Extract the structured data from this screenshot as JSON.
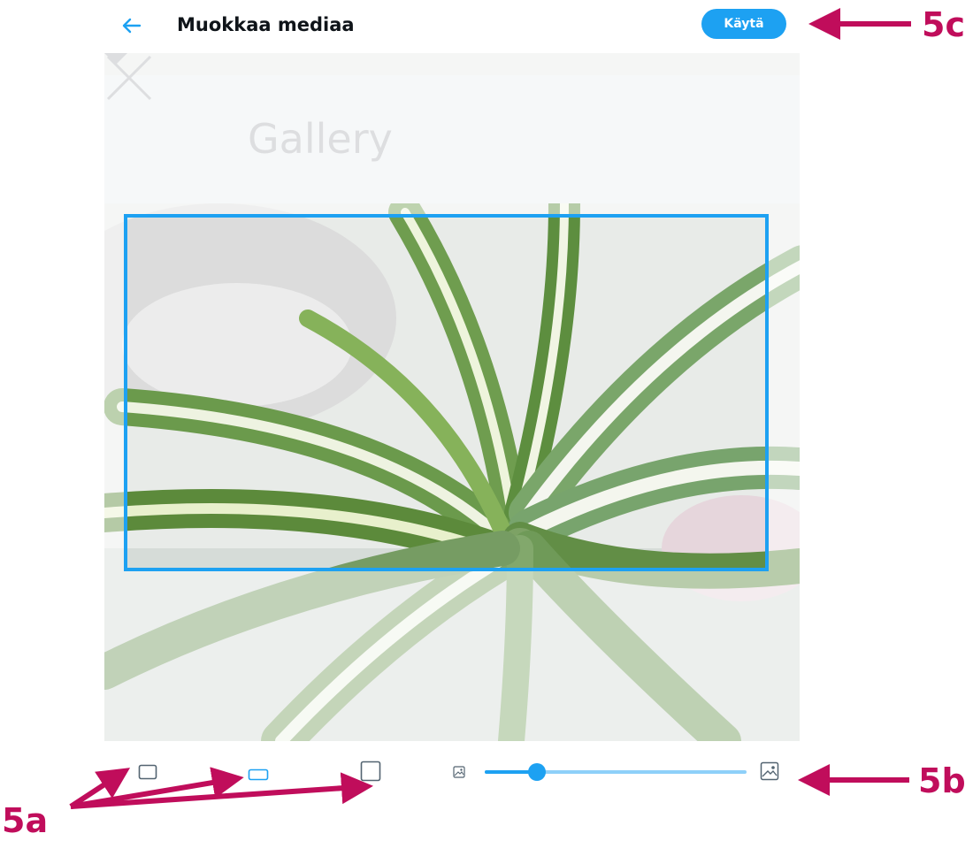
{
  "header": {
    "title": "Muokkaa mediaa",
    "apply_label": "Käytä"
  },
  "photo": {
    "gallery_label": "Gallery"
  },
  "toolbar": {
    "aspect_ratios": [
      "original-ratio",
      "wide-ratio",
      "square-ratio"
    ],
    "selected_ratio": "wide-ratio",
    "zoom_level": 0.2
  },
  "annotations": {
    "a": "5a",
    "b": "5b",
    "c": "5c"
  },
  "colors": {
    "accent": "#1da1f2",
    "annotation": "#c00d5b"
  }
}
